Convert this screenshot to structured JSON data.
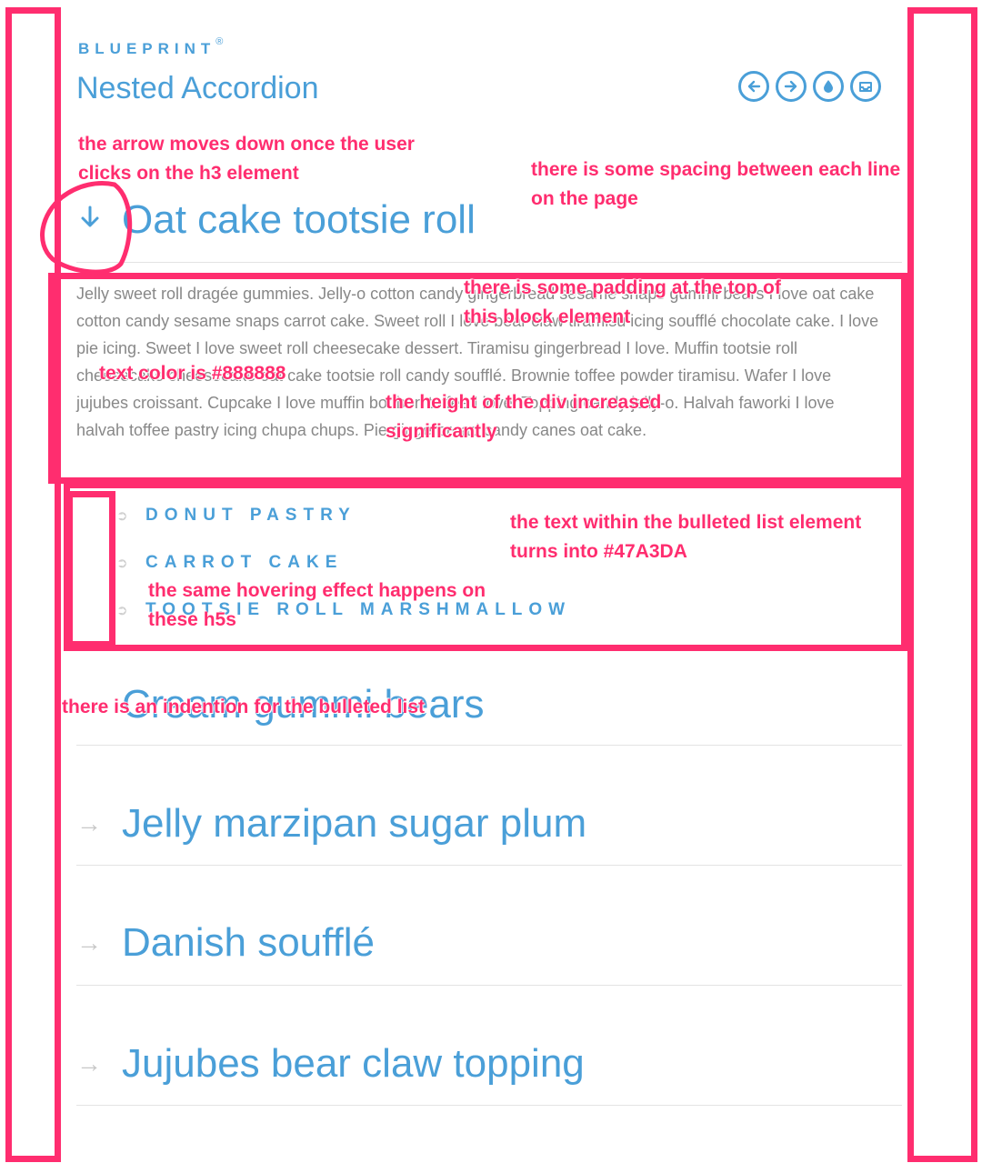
{
  "header": {
    "brand": "BLUEPRINT",
    "brand_mark": "®",
    "title": "Nested Accordion",
    "icons": [
      "arrow-left-icon",
      "arrow-right-icon",
      "drop-icon",
      "inbox-icon"
    ]
  },
  "accordion": {
    "sections": [
      {
        "label": "Oat cake tootsie roll",
        "icon": "arrow-down-icon",
        "open": true
      },
      {
        "label": "Cream gummi bears",
        "icon": "arrow-right-icon",
        "open": false
      },
      {
        "label": "Jelly marzipan sugar plum",
        "icon": "arrow-right-icon",
        "open": false
      },
      {
        "label": "Danish soufflé",
        "icon": "arrow-right-icon",
        "open": false
      },
      {
        "label": "Jujubes bear claw topping",
        "icon": "arrow-right-icon",
        "open": false
      }
    ],
    "panel_text": "Jelly sweet roll dragée gummies. Jelly-o cotton candy gingerbread sesame snaps gummi bears I love oat cake cotton candy sesame snaps carrot cake. Sweet roll I love bear claw tiramisu icing soufflé chocolate cake. I love pie icing. Sweet I love sweet roll cheesecake dessert. Tiramisu gingerbread I love. Muffin tootsie roll cheesecake cheesecake oat cake tootsie roll candy soufflé. Brownie toffee powder tiramisu. Wafer I love jujubes croissant. Cupcake I love muffin bonbon toffee I love. Topping candy jelly-o. Halvah faworki I love halvah toffee pastry icing chupa chups. Pie gingerbread candy canes oat cake.",
    "sub_items": [
      "DONUT PASTRY",
      "CARROT CAKE",
      "TOOTSIE ROLL MARSHMALLOW"
    ]
  },
  "annotations": {
    "arrow_note": [
      "the arrow moves down once the user",
      "clicks on the h3 element"
    ],
    "spacing_note": [
      "there is some spacing between each line",
      "on the page"
    ],
    "padding_note": [
      "there is some padding at the top of",
      "this block element"
    ],
    "color_note": "text color is #888888",
    "height_note": [
      "the height of the div increased",
      "significantly"
    ],
    "list_color_note": [
      "the text within the bulleted list element",
      "turns into #47A3DA"
    ],
    "hover_note": [
      "the same hovering effect happens on",
      "these h5s"
    ],
    "indent_note": "there is an indention for the bulleted list"
  },
  "colors": {
    "accent": "#4a9fd8",
    "body_text": "#888888",
    "annotation": "#ff2d6f",
    "divider": "#e3e3e3"
  }
}
